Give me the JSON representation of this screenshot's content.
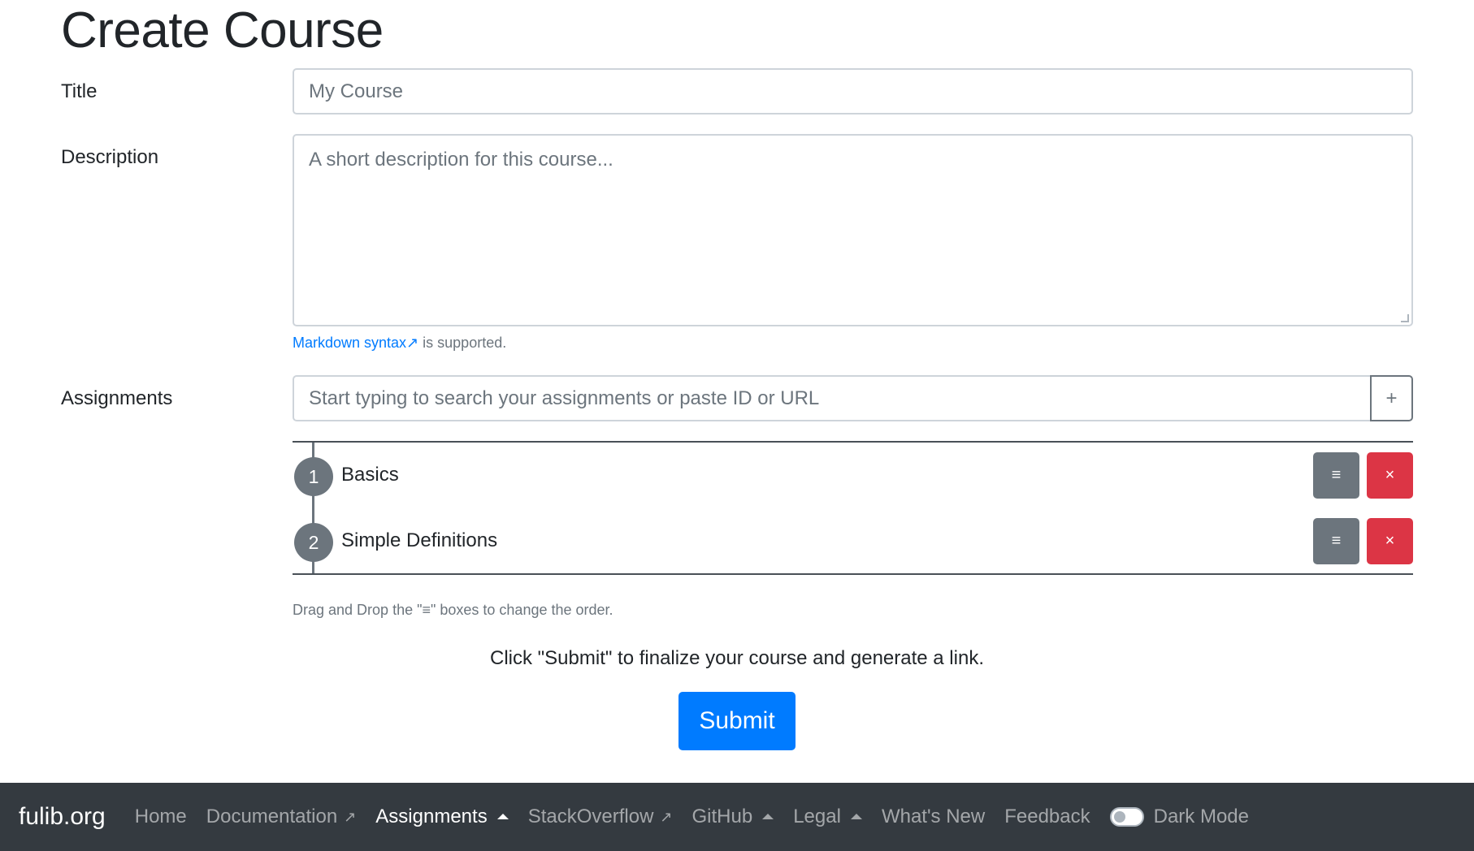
{
  "page": {
    "title": "Create Course"
  },
  "form": {
    "title_label": "Title",
    "title_placeholder": "My Course",
    "description_label": "Description",
    "description_placeholder": "A short description for this course...",
    "markdown_link": "Markdown syntax",
    "markdown_link_icon": "external-link-icon",
    "markdown_suffix": " is supported.",
    "assignments_label": "Assignments",
    "search_placeholder": "Start typing to search your assignments or paste ID or URL",
    "add_glyph": "+"
  },
  "assignments": {
    "items": [
      {
        "number": "1",
        "name": "Basics",
        "handle_glyph": "≡",
        "remove_glyph": "×"
      },
      {
        "number": "2",
        "name": "Simple Definitions",
        "handle_glyph": "≡",
        "remove_glyph": "×"
      }
    ],
    "drag_hint": "Drag and Drop the \"≡\" boxes to change the order."
  },
  "footer_text": "Click \"Submit\" to finalize your course and generate a link.",
  "submit_label": "Submit",
  "navbar": {
    "brand": "fulib.org",
    "items": [
      {
        "label": "Home"
      },
      {
        "label": "Documentation",
        "glyph": "↗"
      },
      {
        "label": "Assignments"
      },
      {
        "label": "StackOverflow",
        "glyph": "↗"
      },
      {
        "label": "GitHub"
      },
      {
        "label": "Legal"
      },
      {
        "label": "What's New"
      },
      {
        "label": "Feedback"
      }
    ],
    "dark_mode_label": "Dark Mode",
    "dark_mode_on": false
  },
  "colors": {
    "primary": "#007bff",
    "danger": "#dc3545",
    "secondary": "#6c757d",
    "navbar_bg": "#343a40"
  }
}
